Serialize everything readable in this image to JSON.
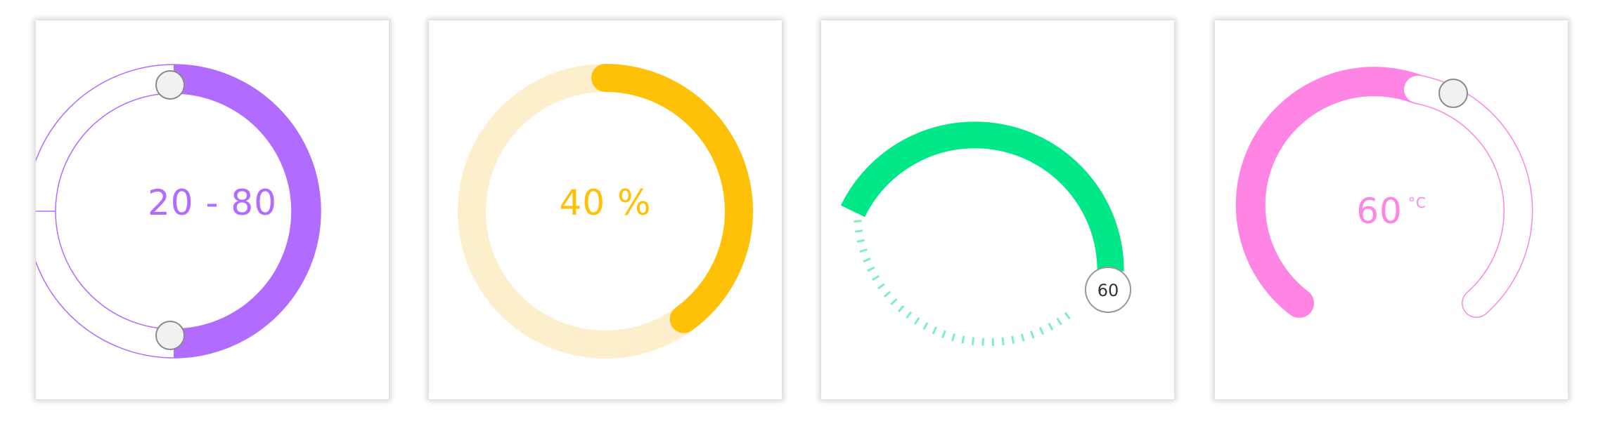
{
  "range_slider": {
    "low": 20,
    "high": 80,
    "separator": "-",
    "display": "20 - 80",
    "color": "#b26bff"
  },
  "percent_gauge": {
    "value": 40,
    "unit": "%",
    "display": "40 %",
    "color": "#ffc107",
    "track_color": "#fdefcc"
  },
  "step_slider": {
    "value": 60,
    "display": "60",
    "color": "#00e887",
    "tick_color": "#7ef0bf"
  },
  "temperature_slider": {
    "value": 60,
    "unit": "°C",
    "display": "60",
    "color": "#ff85e4"
  }
}
